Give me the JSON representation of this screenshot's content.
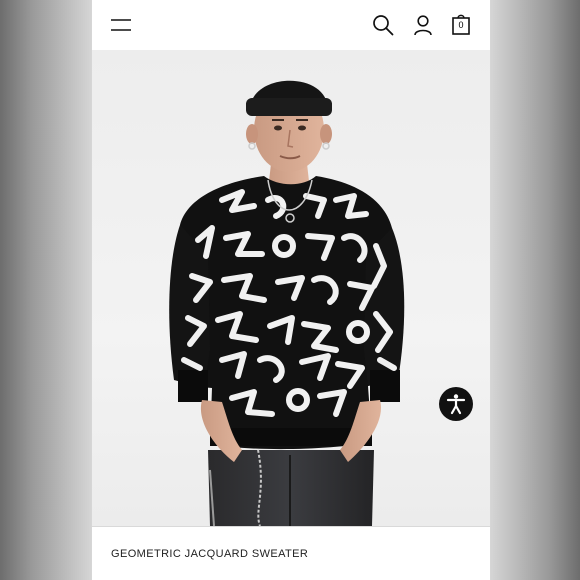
{
  "header": {
    "menu_icon": "hamburger-menu-icon",
    "search_icon": "search-icon",
    "account_icon": "user-icon",
    "bag_icon": "shopping-bag-icon",
    "bag_count": "0"
  },
  "product": {
    "name": "GEOMETRIC JACQUARD SWEATER",
    "image_description_icon": "model-photo"
  },
  "accessibility": {
    "icon": "accessibility-person-icon",
    "color": "#111111"
  },
  "colors": {
    "background_frame": "#8a8a8a",
    "page": "#ffffff",
    "photo_bg": "#efefef",
    "sweater": "#111111",
    "pattern": "#f2f2f2"
  }
}
